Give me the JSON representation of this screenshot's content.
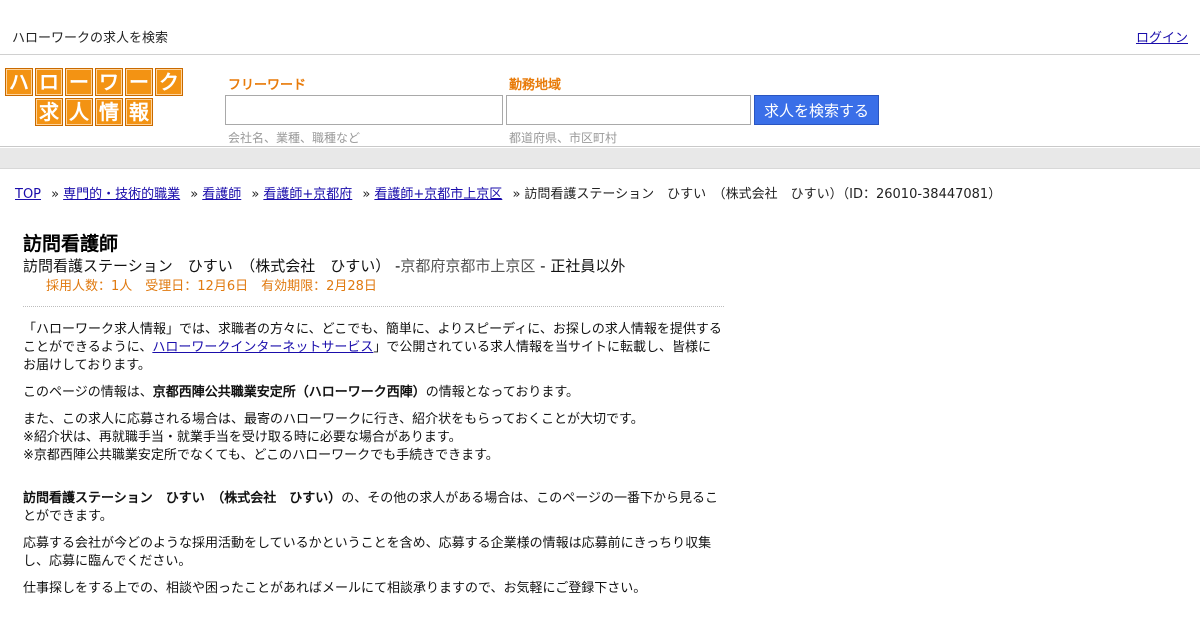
{
  "topbar": {
    "tagline": "ハローワークの求人を検索",
    "login": "ログイン"
  },
  "logo": {
    "row1": [
      "ハ",
      "ロ",
      "ー",
      "ワ",
      "ー",
      "ク"
    ],
    "row2": [
      "求",
      "人",
      "情",
      "報"
    ],
    "color": "#f39313"
  },
  "search": {
    "keyword_label": "フリーワード",
    "keyword_value": "",
    "keyword_hint": "会社名、業種、職種など",
    "area_label": "勤務地域",
    "area_value": "",
    "area_hint": "都道府県、市区町村",
    "button_label": "求人を検索する",
    "button_color": "#3a6fe8"
  },
  "breadcrumb": {
    "items": [
      "TOP",
      "専門的・技術的職業",
      "看護師",
      "看護師+京都府",
      "看護師+京都市上京区"
    ],
    "separator": "»",
    "current": "訪問看護ステーション　ひすい　（株式会社　ひすい）（ID：26010-38447081）"
  },
  "job": {
    "title": "訪問看護師",
    "company": "訪問看護ステーション　ひすい　（株式会社　ひすい）",
    "location_prefix": " -",
    "location": "京都府京都市上京区",
    "employment": " - 正社員以外",
    "meta": "採用人数：1人　受理日：12月6日　有効期限：2月28日"
  },
  "body": {
    "p1_before": "「ハローワーク求人情報」では、求職者の方々に、どこでも、簡単に、よりスピーディに、お探しの求人情報を提供することができるように、",
    "p1_link": "ハローワークインターネットサービス",
    "p1_after": "」で公開されている求人情報を当サイトに転載し、皆様にお届けしております。",
    "p2_before": "このページの情報は、",
    "p2_bold": "京都西陣公共職業安定所（ハローワーク西陣）",
    "p2_after": "の情報となっております。",
    "p3_line1": "また、この求人に応募される場合は、最寄のハローワークに行き、紹介状をもらっておくことが大切です。",
    "p3_line2": "※紹介状は、再就職手当・就業手当を受け取る時に必要な場合があります。",
    "p3_line3": "※京都西陣公共職業安定所でなくても、どこのハローワークでも手続きできます。",
    "p4_bold": "訪問看護ステーション　ひすい　（株式会社　ひすい）",
    "p4_after": "の、その他の求人がある場合は、このページの一番下から見ることができます。",
    "p5": "応募する会社が今どのような採用活動をしているかということを含め、応募する企業様の情報は応募前にきっちり収集し、応募に臨んでください。",
    "p6": "仕事探しをする上での、相談や困ったことがあればメールにて相談承りますので、お気軽にご登録下さい。"
  }
}
